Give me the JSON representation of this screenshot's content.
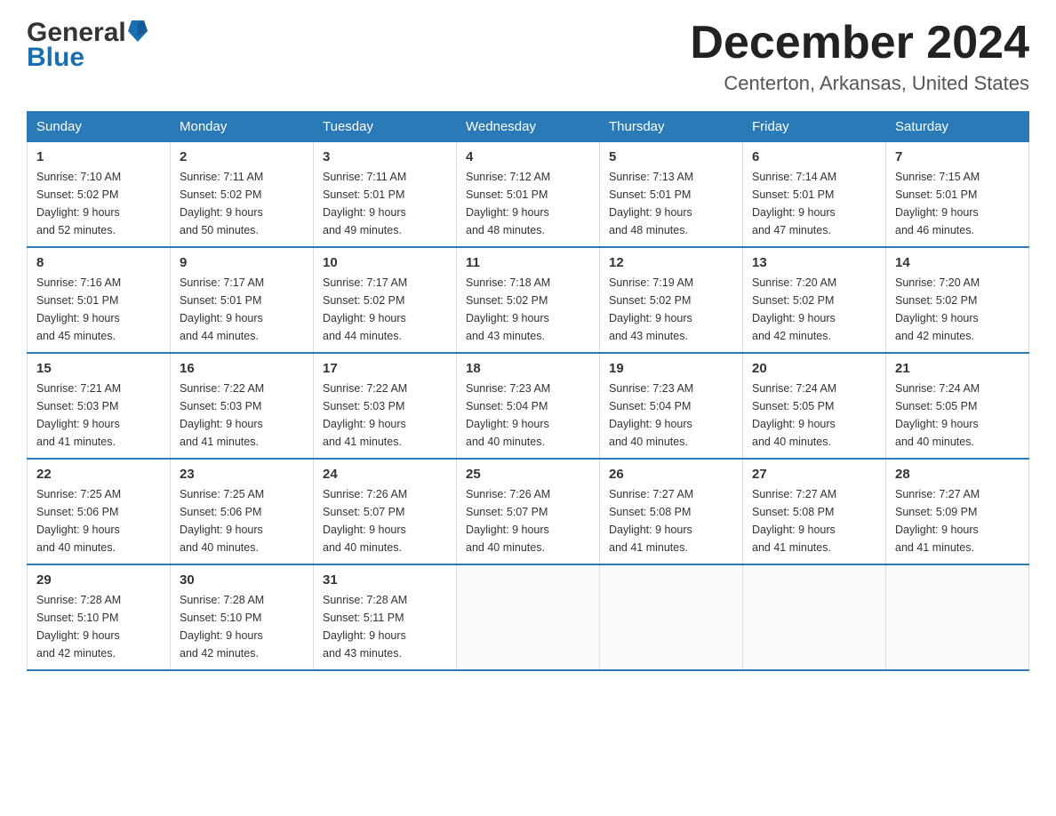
{
  "header": {
    "logo_general": "General",
    "logo_blue": "Blue",
    "month": "December 2024",
    "location": "Centerton, Arkansas, United States"
  },
  "days_of_week": [
    "Sunday",
    "Monday",
    "Tuesday",
    "Wednesday",
    "Thursday",
    "Friday",
    "Saturday"
  ],
  "weeks": [
    [
      {
        "day": "1",
        "sunrise": "Sunrise: 7:10 AM",
        "sunset": "Sunset: 5:02 PM",
        "daylight": "Daylight: 9 hours",
        "daylight2": "and 52 minutes."
      },
      {
        "day": "2",
        "sunrise": "Sunrise: 7:11 AM",
        "sunset": "Sunset: 5:02 PM",
        "daylight": "Daylight: 9 hours",
        "daylight2": "and 50 minutes."
      },
      {
        "day": "3",
        "sunrise": "Sunrise: 7:11 AM",
        "sunset": "Sunset: 5:01 PM",
        "daylight": "Daylight: 9 hours",
        "daylight2": "and 49 minutes."
      },
      {
        "day": "4",
        "sunrise": "Sunrise: 7:12 AM",
        "sunset": "Sunset: 5:01 PM",
        "daylight": "Daylight: 9 hours",
        "daylight2": "and 48 minutes."
      },
      {
        "day": "5",
        "sunrise": "Sunrise: 7:13 AM",
        "sunset": "Sunset: 5:01 PM",
        "daylight": "Daylight: 9 hours",
        "daylight2": "and 48 minutes."
      },
      {
        "day": "6",
        "sunrise": "Sunrise: 7:14 AM",
        "sunset": "Sunset: 5:01 PM",
        "daylight": "Daylight: 9 hours",
        "daylight2": "and 47 minutes."
      },
      {
        "day": "7",
        "sunrise": "Sunrise: 7:15 AM",
        "sunset": "Sunset: 5:01 PM",
        "daylight": "Daylight: 9 hours",
        "daylight2": "and 46 minutes."
      }
    ],
    [
      {
        "day": "8",
        "sunrise": "Sunrise: 7:16 AM",
        "sunset": "Sunset: 5:01 PM",
        "daylight": "Daylight: 9 hours",
        "daylight2": "and 45 minutes."
      },
      {
        "day": "9",
        "sunrise": "Sunrise: 7:17 AM",
        "sunset": "Sunset: 5:01 PM",
        "daylight": "Daylight: 9 hours",
        "daylight2": "and 44 minutes."
      },
      {
        "day": "10",
        "sunrise": "Sunrise: 7:17 AM",
        "sunset": "Sunset: 5:02 PM",
        "daylight": "Daylight: 9 hours",
        "daylight2": "and 44 minutes."
      },
      {
        "day": "11",
        "sunrise": "Sunrise: 7:18 AM",
        "sunset": "Sunset: 5:02 PM",
        "daylight": "Daylight: 9 hours",
        "daylight2": "and 43 minutes."
      },
      {
        "day": "12",
        "sunrise": "Sunrise: 7:19 AM",
        "sunset": "Sunset: 5:02 PM",
        "daylight": "Daylight: 9 hours",
        "daylight2": "and 43 minutes."
      },
      {
        "day": "13",
        "sunrise": "Sunrise: 7:20 AM",
        "sunset": "Sunset: 5:02 PM",
        "daylight": "Daylight: 9 hours",
        "daylight2": "and 42 minutes."
      },
      {
        "day": "14",
        "sunrise": "Sunrise: 7:20 AM",
        "sunset": "Sunset: 5:02 PM",
        "daylight": "Daylight: 9 hours",
        "daylight2": "and 42 minutes."
      }
    ],
    [
      {
        "day": "15",
        "sunrise": "Sunrise: 7:21 AM",
        "sunset": "Sunset: 5:03 PM",
        "daylight": "Daylight: 9 hours",
        "daylight2": "and 41 minutes."
      },
      {
        "day": "16",
        "sunrise": "Sunrise: 7:22 AM",
        "sunset": "Sunset: 5:03 PM",
        "daylight": "Daylight: 9 hours",
        "daylight2": "and 41 minutes."
      },
      {
        "day": "17",
        "sunrise": "Sunrise: 7:22 AM",
        "sunset": "Sunset: 5:03 PM",
        "daylight": "Daylight: 9 hours",
        "daylight2": "and 41 minutes."
      },
      {
        "day": "18",
        "sunrise": "Sunrise: 7:23 AM",
        "sunset": "Sunset: 5:04 PM",
        "daylight": "Daylight: 9 hours",
        "daylight2": "and 40 minutes."
      },
      {
        "day": "19",
        "sunrise": "Sunrise: 7:23 AM",
        "sunset": "Sunset: 5:04 PM",
        "daylight": "Daylight: 9 hours",
        "daylight2": "and 40 minutes."
      },
      {
        "day": "20",
        "sunrise": "Sunrise: 7:24 AM",
        "sunset": "Sunset: 5:05 PM",
        "daylight": "Daylight: 9 hours",
        "daylight2": "and 40 minutes."
      },
      {
        "day": "21",
        "sunrise": "Sunrise: 7:24 AM",
        "sunset": "Sunset: 5:05 PM",
        "daylight": "Daylight: 9 hours",
        "daylight2": "and 40 minutes."
      }
    ],
    [
      {
        "day": "22",
        "sunrise": "Sunrise: 7:25 AM",
        "sunset": "Sunset: 5:06 PM",
        "daylight": "Daylight: 9 hours",
        "daylight2": "and 40 minutes."
      },
      {
        "day": "23",
        "sunrise": "Sunrise: 7:25 AM",
        "sunset": "Sunset: 5:06 PM",
        "daylight": "Daylight: 9 hours",
        "daylight2": "and 40 minutes."
      },
      {
        "day": "24",
        "sunrise": "Sunrise: 7:26 AM",
        "sunset": "Sunset: 5:07 PM",
        "daylight": "Daylight: 9 hours",
        "daylight2": "and 40 minutes."
      },
      {
        "day": "25",
        "sunrise": "Sunrise: 7:26 AM",
        "sunset": "Sunset: 5:07 PM",
        "daylight": "Daylight: 9 hours",
        "daylight2": "and 40 minutes."
      },
      {
        "day": "26",
        "sunrise": "Sunrise: 7:27 AM",
        "sunset": "Sunset: 5:08 PM",
        "daylight": "Daylight: 9 hours",
        "daylight2": "and 41 minutes."
      },
      {
        "day": "27",
        "sunrise": "Sunrise: 7:27 AM",
        "sunset": "Sunset: 5:08 PM",
        "daylight": "Daylight: 9 hours",
        "daylight2": "and 41 minutes."
      },
      {
        "day": "28",
        "sunrise": "Sunrise: 7:27 AM",
        "sunset": "Sunset: 5:09 PM",
        "daylight": "Daylight: 9 hours",
        "daylight2": "and 41 minutes."
      }
    ],
    [
      {
        "day": "29",
        "sunrise": "Sunrise: 7:28 AM",
        "sunset": "Sunset: 5:10 PM",
        "daylight": "Daylight: 9 hours",
        "daylight2": "and 42 minutes."
      },
      {
        "day": "30",
        "sunrise": "Sunrise: 7:28 AM",
        "sunset": "Sunset: 5:10 PM",
        "daylight": "Daylight: 9 hours",
        "daylight2": "and 42 minutes."
      },
      {
        "day": "31",
        "sunrise": "Sunrise: 7:28 AM",
        "sunset": "Sunset: 5:11 PM",
        "daylight": "Daylight: 9 hours",
        "daylight2": "and 43 minutes."
      },
      null,
      null,
      null,
      null
    ]
  ]
}
